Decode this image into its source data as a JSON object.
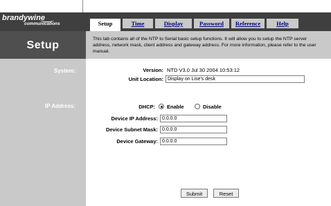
{
  "brand": {
    "name": "brandywine",
    "tagline": "communications"
  },
  "page": {
    "title": "Setup"
  },
  "tabs": [
    {
      "label": "Setup",
      "active": true
    },
    {
      "label": "Time",
      "active": false
    },
    {
      "label": "Display",
      "active": false
    },
    {
      "label": "Password",
      "active": false
    },
    {
      "label": "Reference",
      "active": false
    },
    {
      "label": "Help",
      "active": false
    }
  ],
  "description": "This tab contains all of the NTP to Serial basic setup functions. It will allow you to setup the NTP server address, network mask, client address and gateway address.  For more information, please refer to the user manual.",
  "sections": {
    "system": "System:",
    "ip": "IP Address:"
  },
  "system": {
    "version_label": "Version:",
    "version_value": "NTD V3.0 Jul 30 2004 10:53:12",
    "location_label": "Unit Location:",
    "location_value": "Display on Lise's desk"
  },
  "ip": {
    "dhcp_label": "DHCP:",
    "dhcp_enable": "Enable",
    "dhcp_disable": "Disable",
    "dhcp_selected": "Enable",
    "address_label": "Device IP Address:",
    "address_value": "0.0.0.0",
    "mask_label": "Device Subnet Mask:",
    "mask_value": "0.0.0.0",
    "gateway_label": "Device Gateway:",
    "gateway_value": "0.0.0.0"
  },
  "buttons": {
    "submit": "Submit",
    "reset": "Reset"
  },
  "colors": {
    "dark": "#3f3f3f",
    "panel": "#c9c9c9",
    "link": "#000080"
  }
}
